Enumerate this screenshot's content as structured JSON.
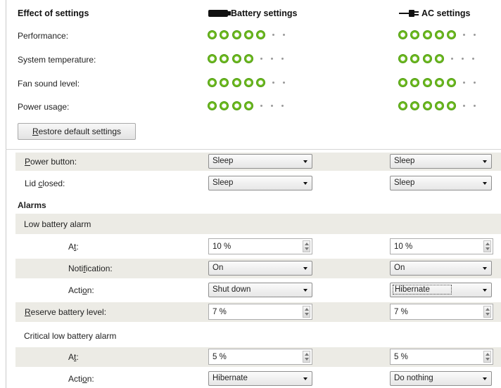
{
  "header": {
    "effect_title": "Effect of settings",
    "battery_title": "Battery settings",
    "ac_title": "AC settings",
    "battery_icon": "battery-icon",
    "ac_icon": "plug-icon"
  },
  "effects": [
    {
      "label": "Performance:",
      "battery": {
        "filled": 5,
        "total": 7
      },
      "ac": {
        "filled": 5,
        "total": 7
      }
    },
    {
      "label": "System temperature:",
      "battery": {
        "filled": 4,
        "total": 7
      },
      "ac": {
        "filled": 4,
        "total": 7
      }
    },
    {
      "label": "Fan sound level:",
      "battery": {
        "filled": 5,
        "total": 7
      },
      "ac": {
        "filled": 5,
        "total": 7
      }
    },
    {
      "label": "Power usage:",
      "battery": {
        "filled": 4,
        "total": 7
      },
      "ac": {
        "filled": 5,
        "total": 7
      }
    }
  ],
  "colors": {
    "dot_green": "#6dba1f",
    "row_shade": "#ecebe5"
  },
  "restore_button": {
    "prefix": "",
    "mnemonic": "R",
    "rest": "estore default settings"
  },
  "power_button": {
    "mnemonic": "P",
    "rest": "ower button:",
    "battery": "Sleep",
    "ac": "Sleep"
  },
  "lid_closed": {
    "prefix": "Lid ",
    "mnemonic": "c",
    "rest": "losed:",
    "battery": "Sleep",
    "ac": "Sleep"
  },
  "alarms": {
    "title": "Alarms",
    "low": {
      "title": "Low battery alarm",
      "at": {
        "prefix": "A",
        "mnemonic": "t",
        "rest": ":",
        "battery": "10 %",
        "ac": "10 %"
      },
      "notification": {
        "prefix": "Noti",
        "mnemonic": "f",
        "rest": "ication:",
        "battery": "On",
        "ac": "On"
      },
      "action": {
        "prefix": "Acti",
        "mnemonic": "o",
        "rest": "n:",
        "battery": "Shut down",
        "ac": "Hibernate"
      }
    },
    "reserve": {
      "mnemonic": "R",
      "rest": "eserve battery level:",
      "battery": "7 %",
      "ac": "7 %"
    },
    "critical": {
      "title": "Critical low battery alarm",
      "at": {
        "prefix": "A",
        "mnemonic": "t",
        "rest": ":",
        "battery": "5 %",
        "ac": "5 %"
      },
      "action": {
        "prefix": "Acti",
        "mnemonic": "o",
        "rest": "n:",
        "battery": "Hibernate",
        "ac": "Do nothing"
      }
    }
  }
}
